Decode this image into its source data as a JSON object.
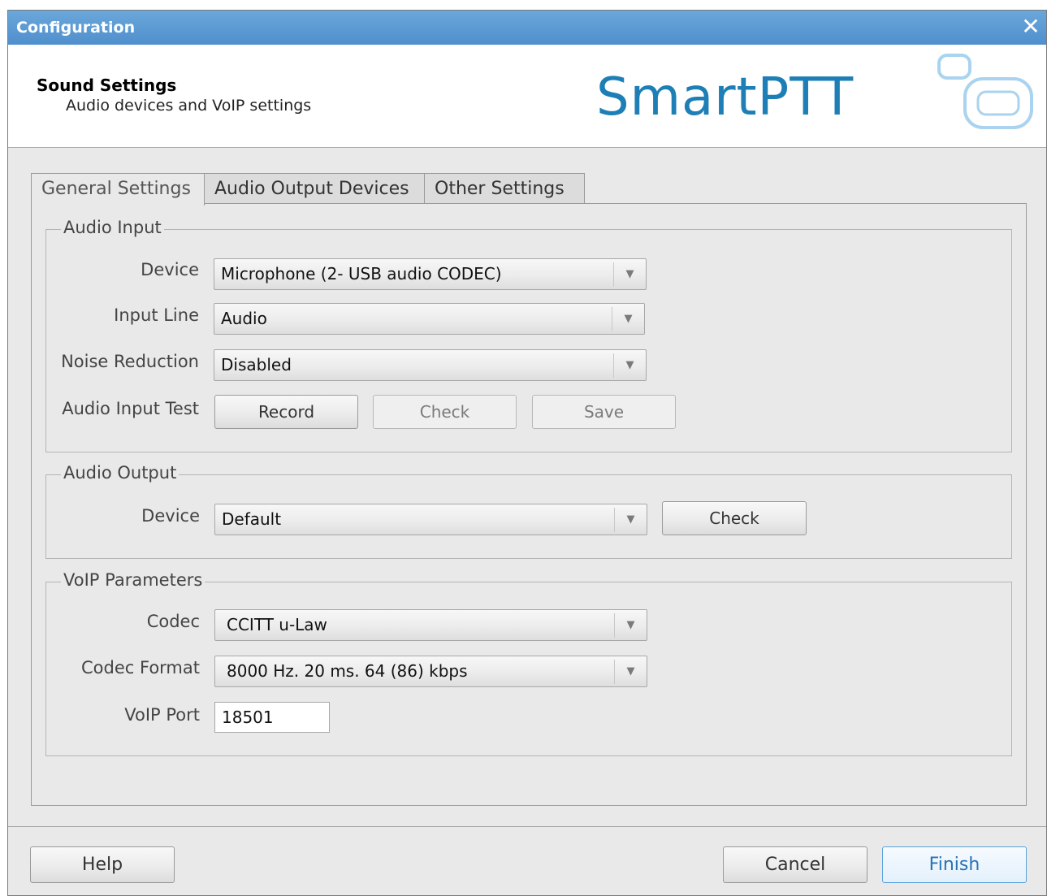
{
  "window": {
    "title": "Configuration"
  },
  "header": {
    "title": "Sound Settings",
    "subtitle": "Audio devices and VoIP settings",
    "logo_text": "SmartPTT"
  },
  "tabs": [
    {
      "label": "General Settings",
      "active": true
    },
    {
      "label": "Audio Output Devices",
      "active": false
    },
    {
      "label": "Other Settings",
      "active": false
    }
  ],
  "audio_input": {
    "legend": "Audio Input",
    "device_label": "Device",
    "device_value": "Microphone (2- USB audio CODEC)",
    "input_line_label": "Input Line",
    "input_line_value": "Audio",
    "noise_label": "Noise Reduction",
    "noise_value": "Disabled",
    "test_label": "Audio Input Test",
    "record_label": "Record",
    "check_label": "Check",
    "save_label": "Save"
  },
  "audio_output": {
    "legend": "Audio Output",
    "device_label": "Device",
    "device_value": "Default",
    "check_label": "Check"
  },
  "voip": {
    "legend": "VoIP Parameters",
    "codec_label": "Codec",
    "codec_value": "CCITT u-Law",
    "format_label": "Codec Format",
    "format_value": "8000 Hz. 20 ms. 64 (86) kbps",
    "port_label": "VoIP Port",
    "port_value": "18501"
  },
  "footer": {
    "help_label": "Help",
    "cancel_label": "Cancel",
    "finish_label": "Finish"
  },
  "colors": {
    "titlebar": "#5a9ad4",
    "logo": "#1d7fb5",
    "finish_border": "#5aa3dc"
  }
}
